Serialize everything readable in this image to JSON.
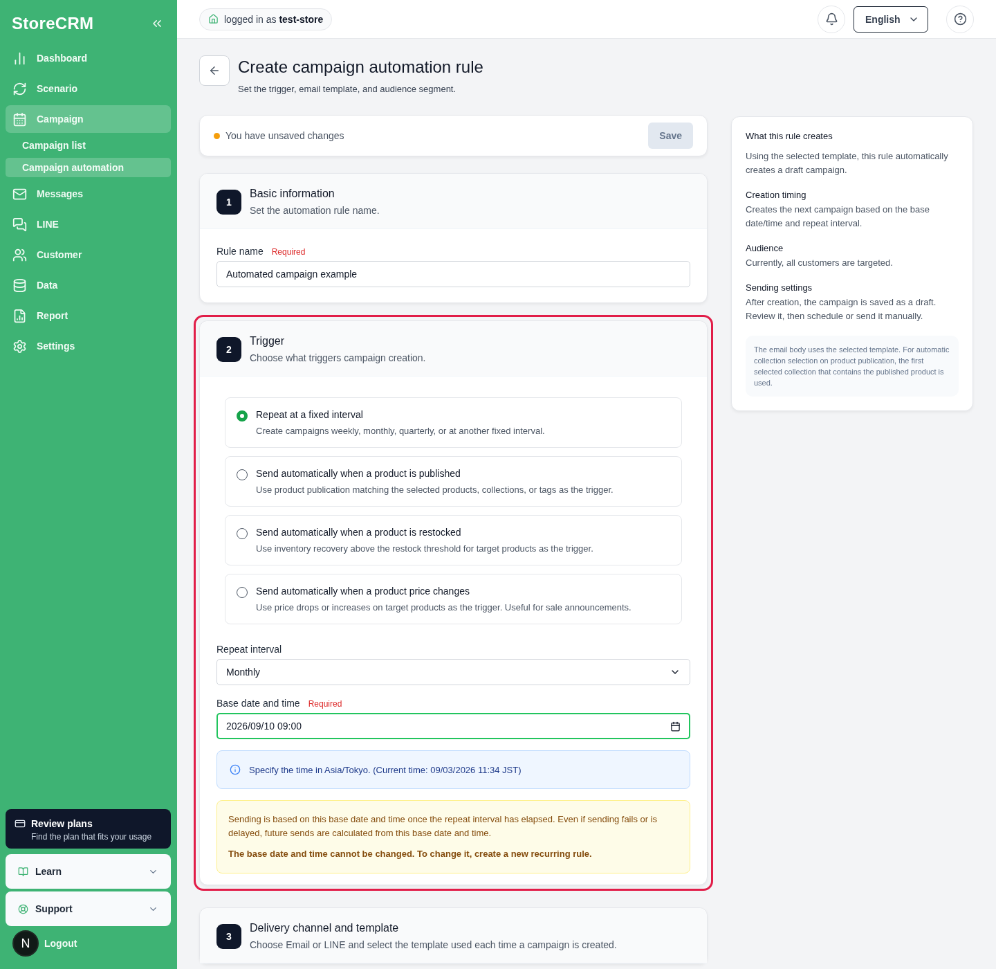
{
  "sidebar": {
    "logo": "StoreCRM",
    "items": [
      {
        "label": "Dashboard",
        "selected": false
      },
      {
        "label": "Scenario",
        "selected": false
      },
      {
        "label": "Campaign",
        "selected": true,
        "children": [
          {
            "label": "Campaign list",
            "selected": false
          },
          {
            "label": "Campaign automation",
            "selected": true
          }
        ]
      },
      {
        "label": "Messages",
        "selected": false
      },
      {
        "label": "LINE",
        "selected": false
      },
      {
        "label": "Customer",
        "selected": false
      },
      {
        "label": "Data",
        "selected": false
      },
      {
        "label": "Report",
        "selected": false
      },
      {
        "label": "Settings",
        "selected": false
      }
    ],
    "promo": {
      "title": "Review plans",
      "subtitle": "Find the plan that fits your usage"
    },
    "accordions": [
      {
        "label": "Learn",
        "expanded": false
      },
      {
        "label": "Support",
        "expanded": false
      }
    ],
    "logout": "Logout",
    "avatar": "N"
  },
  "topbar": {
    "login_prefix": "logged in as",
    "login_user": "test-store",
    "language": "English"
  },
  "page": {
    "title": "Create campaign automation rule",
    "subtitle": "Set the trigger, email template, and audience segment."
  },
  "unsaved": {
    "message": "You have unsaved changes",
    "button": "Save",
    "disabled": true
  },
  "sections": [
    {
      "kind": "basic",
      "number": "1",
      "title": "Basic information",
      "subtitle": "Set the automation rule name.",
      "highlighted": false,
      "field": {
        "label": "Rule name",
        "required": "Required",
        "value": "Automated campaign example"
      }
    },
    {
      "kind": "trigger",
      "number": "2",
      "title": "Trigger",
      "subtitle": "Choose what triggers campaign creation.",
      "highlighted": true,
      "options": [
        {
          "title": "Repeat at a fixed interval",
          "description": "Create campaigns weekly, monthly, quarterly, or at another fixed interval.",
          "selected": true
        },
        {
          "title": "Send automatically when a product is published",
          "description": "Use product publication matching the selected products, collections, or tags as the trigger.",
          "selected": false
        },
        {
          "title": "Send automatically when a product is restocked",
          "description": "Use inventory recovery above the restock threshold for target products as the trigger.",
          "selected": false
        },
        {
          "title": "Send automatically when a product price changes",
          "description": "Use price drops or increases on target products as the trigger. Useful for sale announcements.",
          "selected": false
        }
      ],
      "interval": {
        "label": "Repeat interval",
        "value": "Monthly"
      },
      "base_date": {
        "label": "Base date and time",
        "required": "Required",
        "value": "2026/09/10 09:00",
        "focused": true
      },
      "info": "Specify the time in Asia/Tokyo. (Current time: 09/03/2026 11:34 JST)",
      "warning": "Sending is based on this base date and time once the repeat interval has elapsed. Even if sending fails or is delayed, future sends are calculated from this base date and time.",
      "warning_strong": "The base date and time cannot be changed. To change it, create a new recurring rule."
    },
    {
      "kind": "delivery",
      "number": "3",
      "title": "Delivery channel and template",
      "subtitle": "Choose Email or LINE and select the template used each time a campaign is created.",
      "highlighted": false
    }
  ],
  "summary": {
    "blocks": [
      {
        "title": "What this rule creates",
        "text": "Using the selected template, this rule automatically creates a draft campaign."
      },
      {
        "title": "Creation timing",
        "text": "Creates the next campaign based on the base date/time and repeat interval."
      },
      {
        "title": "Audience",
        "text": "Currently, all customers are targeted."
      },
      {
        "title": "Sending settings",
        "text": "After creation, the campaign is saved as a draft. Review it, then schedule or send it manually."
      }
    ],
    "note": "The email body uses the selected template. For automatic collection selection on product publication, the first selected collection that contains the published product is used."
  }
}
